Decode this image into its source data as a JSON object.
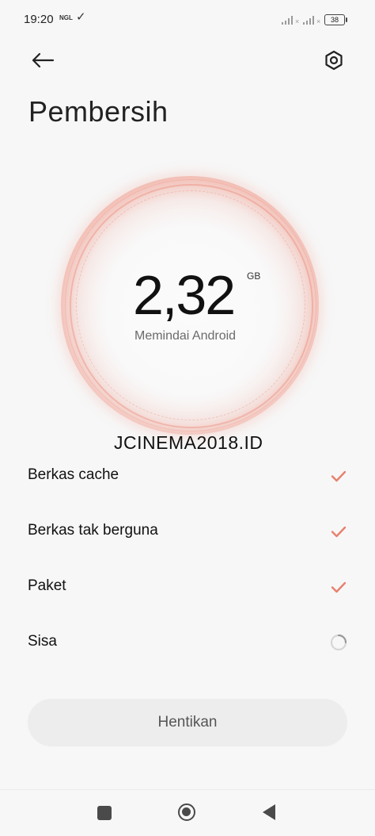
{
  "status_bar": {
    "time": "19:20",
    "mini_label": "NGL",
    "check_icon": "check-icon",
    "battery": "38"
  },
  "header": {
    "back_icon": "arrow-left-icon",
    "settings_icon": "hexagon-settings-icon",
    "title": "Pembersih"
  },
  "scan": {
    "size_value": "2,32",
    "size_unit": "GB",
    "status_label": "Memindai Android"
  },
  "watermark": "JCINEMA2018.ID",
  "tasks": [
    {
      "label": "Berkas cache",
      "state": "done"
    },
    {
      "label": "Berkas tak berguna",
      "state": "done"
    },
    {
      "label": "Paket",
      "state": "done"
    },
    {
      "label": "Sisa",
      "state": "loading"
    }
  ],
  "actions": {
    "stop_label": "Hentikan"
  },
  "colors": {
    "accent": "#e8806e",
    "background": "#f7f7f7",
    "button_bg": "#ededed"
  }
}
